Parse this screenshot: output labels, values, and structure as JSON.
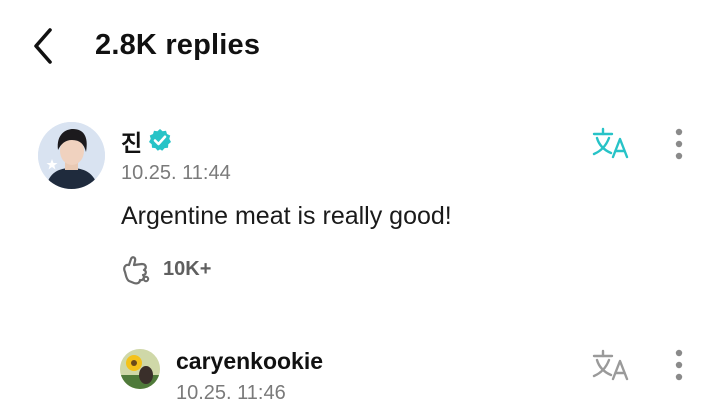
{
  "header": {
    "title": "2.8K replies",
    "back_icon": "chevron-left-icon"
  },
  "comment": {
    "author": "진",
    "verified": true,
    "timestamp": "10.25. 11:44",
    "text": "Argentine meat is really good!",
    "like_count": "10K+",
    "icons": {
      "translate": "translate-icon",
      "more": "more-vertical-icon",
      "like": "like-icon"
    },
    "accent_color": "#27c3c7"
  },
  "reply": {
    "author": "caryenkookie",
    "timestamp": "10.25. 11:46",
    "translate_color": "#9a9a9a"
  }
}
